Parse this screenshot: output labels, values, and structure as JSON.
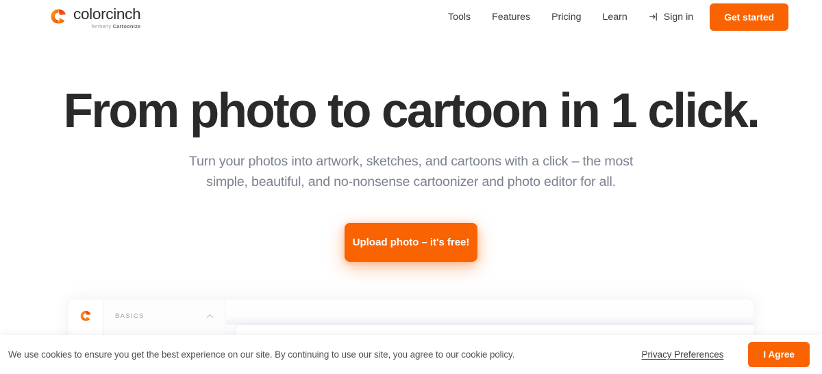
{
  "brand": {
    "name": "colorcinch",
    "tagline_prefix": "formerly ",
    "tagline_strong": "Cartoonize",
    "logo_icon": "colorcinch-logo-mark",
    "accent_color": "#f96302"
  },
  "nav": {
    "links": [
      {
        "label": "Tools"
      },
      {
        "label": "Features"
      },
      {
        "label": "Pricing"
      },
      {
        "label": "Learn"
      }
    ],
    "signin": {
      "label": "Sign in",
      "icon": "sign-in-arrow-icon"
    },
    "cta": {
      "label": "Get started"
    }
  },
  "hero": {
    "headline": "From photo to cartoon in 1 click.",
    "subheadline": "Turn your photos into artwork, sketches, and cartoons with a click – the most simple, beautiful, and no-nonsense cartoonizer and photo editor for all.",
    "cta": {
      "label": "Upload photo – it's free!"
    }
  },
  "editor_preview": {
    "rail_icon": "colorcinch-logo-mark",
    "panel": {
      "title": "BASICS",
      "collapse_icon": "chevron-up-icon"
    }
  },
  "cookie_banner": {
    "message": "We use cookies to ensure you get the best experience on our site. By continuing to use our site, you agree to our cookie policy.",
    "privacy_link": "Privacy Preferences",
    "agree_button": "I Agree"
  }
}
